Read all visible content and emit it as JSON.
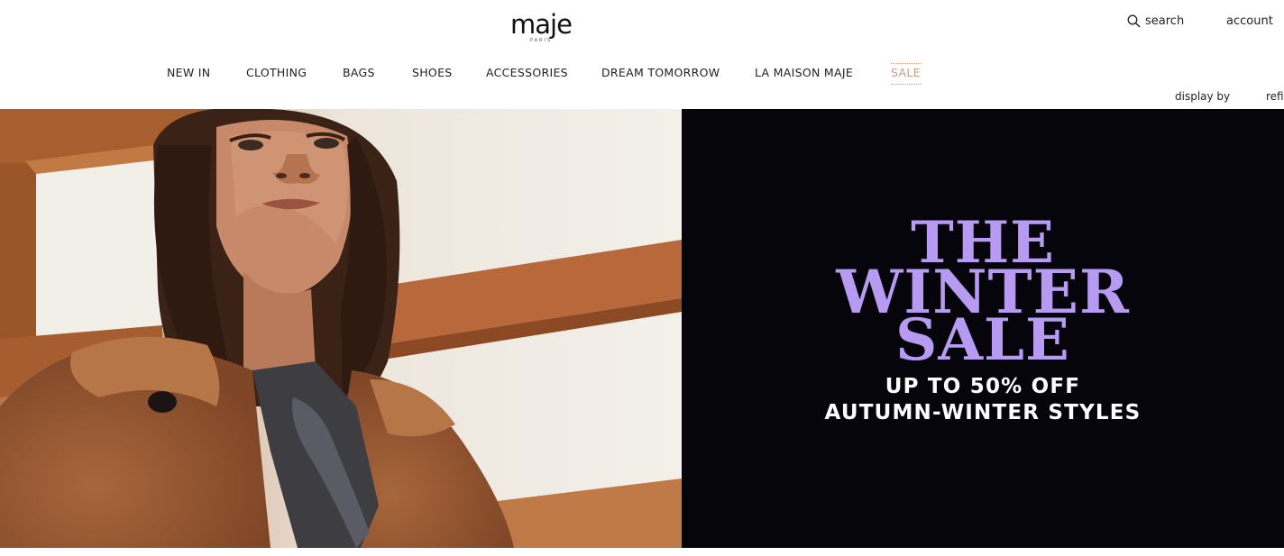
{
  "header": {
    "logo": {
      "word": "maje",
      "sub": "PARIS"
    },
    "search_label": "search",
    "account_label": "account"
  },
  "nav": {
    "items": [
      {
        "label": "NEW IN"
      },
      {
        "label": "CLOTHING"
      },
      {
        "label": "BAGS"
      },
      {
        "label": "SHOES"
      },
      {
        "label": "ACCESSORIES"
      },
      {
        "label": "DREAM TOMORROW"
      },
      {
        "label": "LA MAISON MAJE"
      },
      {
        "label": "SALE"
      }
    ]
  },
  "toolbar": {
    "display_label": "display by",
    "refine_label": "refi"
  },
  "hero": {
    "photo_alt": "",
    "title_lines": [
      "THE",
      "WINTER",
      "SALE"
    ],
    "subtitle_lines": [
      "UP TO 50% OFF",
      "AUTUMN-WINTER STYLES"
    ]
  },
  "colors": {
    "sale_accent": "#c79a86",
    "promo_background": "#06050c",
    "promo_title": "#b79af2",
    "promo_subtitle": "#ffffff"
  },
  "icons": {
    "search": "search-icon"
  }
}
